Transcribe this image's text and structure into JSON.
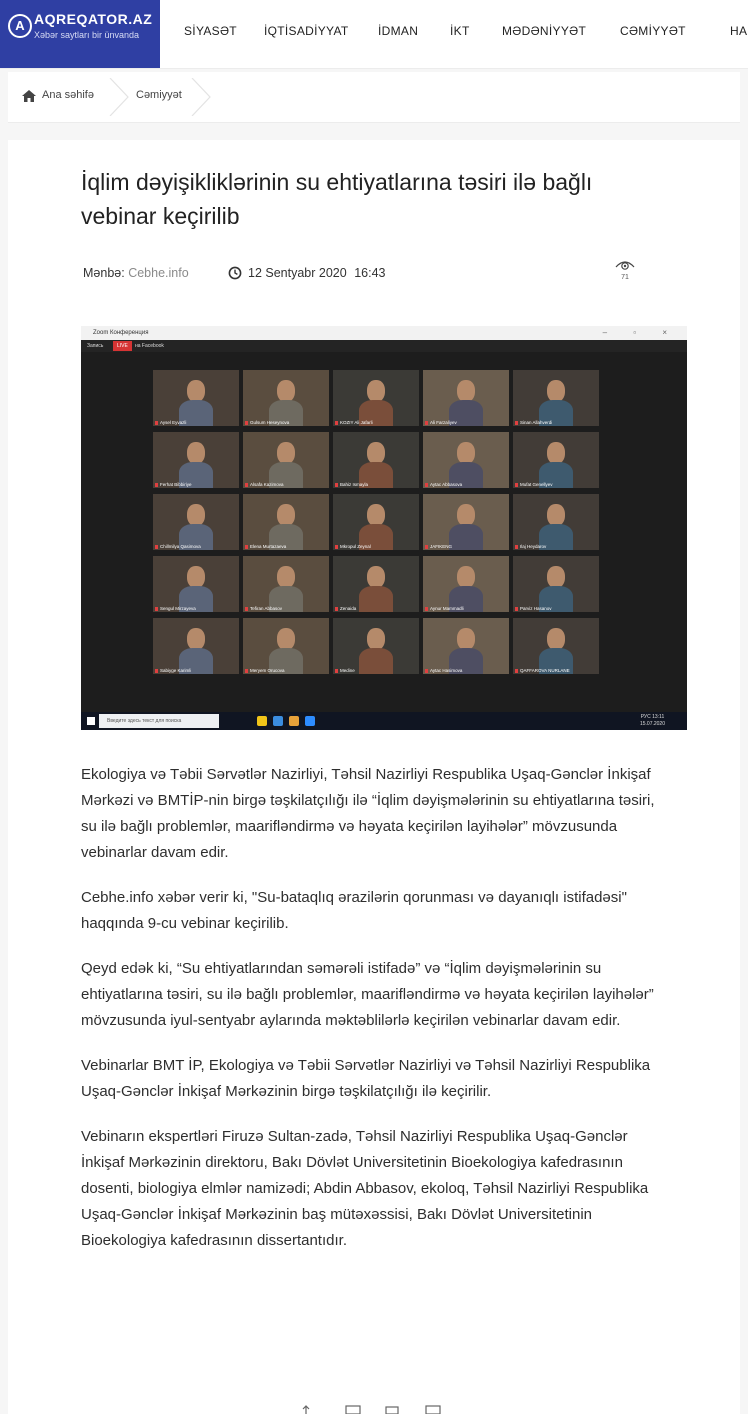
{
  "logo": {
    "mark": "A",
    "name": "AQREQATOR.AZ",
    "tagline": "Xəbər saytları bir ünvanda",
    "color": "#2f3fa3"
  },
  "nav": {
    "items": [
      "SİYASƏT",
      "İQTİSADİYYAT",
      "İDMAN",
      "İKT",
      "MƏDƏNİYYƏT",
      "CƏMİYYƏT",
      "HADİ"
    ]
  },
  "breadcrumb": {
    "home_icon": "home-icon",
    "home": "Ana səhifə",
    "current": "Cəmiyyət"
  },
  "article": {
    "title": "İqlim dəyişikliklərinin su ehtiyatlarına təsiri ilə bağlı vebinar keçirilib",
    "source_label": "Mənbə:",
    "source": "Cebhe.info",
    "date": "12 Sentyabr 2020",
    "time": "16:43",
    "views": "71",
    "paragraphs": [
      "Ekologiya və Təbii Sərvətlər Nazirliyi, Təhsil Nazirliyi Respublika Uşaq-Gənclər İnkişaf Mərkəzi və BMTİP-nin birgə təşkilatçılığı ilə “İqlim dəyişmələrinin su ehtiyatlarına təsiri, su ilə bağlı problemlər, maarifləndirmə və həyata keçirilən layihələr” mövzusunda vebinarlar davam edir.",
      "Cebhe.info xəbər verir ki, \"Su-bataqlıq ərazilərin qorunması və dayanıqlı istifadəsi\" haqqında 9-cu vebinar keçirilib.",
      "Qeyd edək ki, “Su ehtiyatlarından səmərəli istifadə” və “İqlim dəyişmələrinin su ehtiyatlarına təsiri, su ilə bağlı problemlər, maarifləndirmə və həyata keçirilən layihələr” mövzusunda iyul-sentyabr aylarında məktəblilərlə keçirilən vebinarlar davam edir.",
      "Vebinarlar BMT İP, Ekologiya və Təbii Sərvətlər Nazirliyi və Təhsil Nazirliyi Respublika Uşaq-Gənclər İnkişaf Mərkəzinin birgə təşkilatçılığı ilə keçirilir.",
      "Vebinarın ekspertləri Firuzə Sultan-zadə, Təhsil Nazirliyi Respublika Uşaq-Gənclər İnkişaf Mərkəzinin direktoru, Bakı Dövlət Universitetinin Bioekologiya kafedrasının dosenti, biologiya elmlər namizədi; Abdin Abbasov, ekoloq, Təhsil Nazirliyi Respublika Uşaq-Gənclər İnkişaf Mərkəzinin baş mütəxəssisi, Bakı Dövlət Universitetinin Bioekologiya kafedrasının dissertantıdır."
    ]
  },
  "photo": {
    "window_title": "Zoom Конференция",
    "recording": "Запись",
    "live_badge": "LIVE",
    "live_target": "на Facebook",
    "search_placeholder": "Введите здесь текст для поиска",
    "tray_lang": "РУС",
    "tray_time": "13:11",
    "tray_date": "15.07.2020",
    "participants": [
      "Aysel Eyvazli",
      "Gulsum Heseynova",
      "KOZIY Ali Jafarli",
      "Ali Farzaliyev",
      "Sinan Allahverdi",
      "Ferhat Bibbiriye",
      "Alsafa Kazimova",
      "Bahiz Ismayla",
      "Aytac Abbasova",
      "Mufat Genellyev",
      "Chillmilya Qasimova",
      "Elena Murtazaeva",
      "Mkropul Zeynal",
      "JAFIKENG",
      "Ilaj Heydarov",
      "Sengul Mirzayeva",
      "Tefiran Abbasov",
      "Zenaida",
      "Aynur Mammadli",
      "Parviz Hasanov",
      "Sabiyge Karimli",
      "Meryem Orucova",
      "Medine",
      "Aytac Hasimova",
      "QAFFAROVA NURLANE"
    ]
  },
  "share": {
    "icons": [
      "share-icon",
      "print-icon",
      "mail-icon",
      "bookmark-icon"
    ]
  }
}
